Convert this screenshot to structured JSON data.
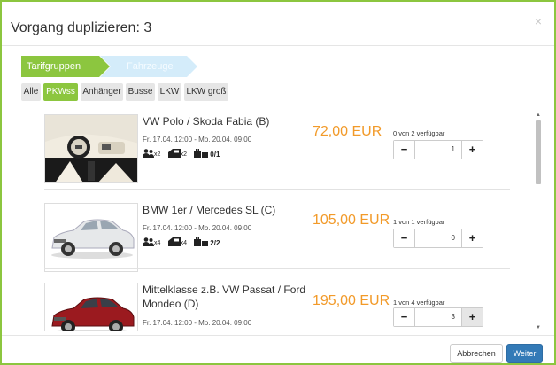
{
  "dialog": {
    "title": "Vorgang duplizieren: 3",
    "close_label": "×"
  },
  "steps": [
    {
      "label": "Tarifgruppen",
      "active": true
    },
    {
      "label": "Fahrzeuge",
      "active": false
    }
  ],
  "filters": [
    {
      "label": "Alle",
      "active": false
    },
    {
      "label": "PKWss",
      "active": true
    },
    {
      "label": "Anhänger",
      "active": false
    },
    {
      "label": "Busse",
      "active": false
    },
    {
      "label": "LKW",
      "active": false
    },
    {
      "label": "LKW groß",
      "active": false
    }
  ],
  "vehicles": [
    {
      "name": "VW Polo / Skoda Fabia (B)",
      "dates": "Fr. 17.04. 12:00 - Mo. 20.04. 09:00",
      "seats": "x2",
      "doors": "x2",
      "luggage": "0/1",
      "price": "72,00 EUR",
      "availability": "0 von 2 verfügbar",
      "quantity": "1",
      "minus": "−",
      "plus": "+"
    },
    {
      "name": "BMW 1er / Mercedes SL (C)",
      "dates": "Fr. 17.04. 12:00 - Mo. 20.04. 09:00",
      "seats": "x4",
      "doors": "x4",
      "luggage": "2/2",
      "price": "105,00 EUR",
      "availability": "1 von 1 verfügbar",
      "quantity": "0",
      "minus": "−",
      "plus": "+"
    },
    {
      "name": "Mittelklasse z.B. VW Passat / Ford Mondeo (D)",
      "dates": "Fr. 17.04. 12:00 - Mo. 20.04. 09:00",
      "price": "195,00 EUR",
      "availability": "1 von 4 verfügbar",
      "quantity": "3",
      "minus": "−",
      "plus": "+"
    }
  ],
  "footer": {
    "cancel_label": "Abbrechen",
    "next_label": "Weiter"
  },
  "colors": {
    "accent_green": "#8cc63f",
    "price_orange": "#f29a29",
    "primary_blue": "#337ab7"
  }
}
